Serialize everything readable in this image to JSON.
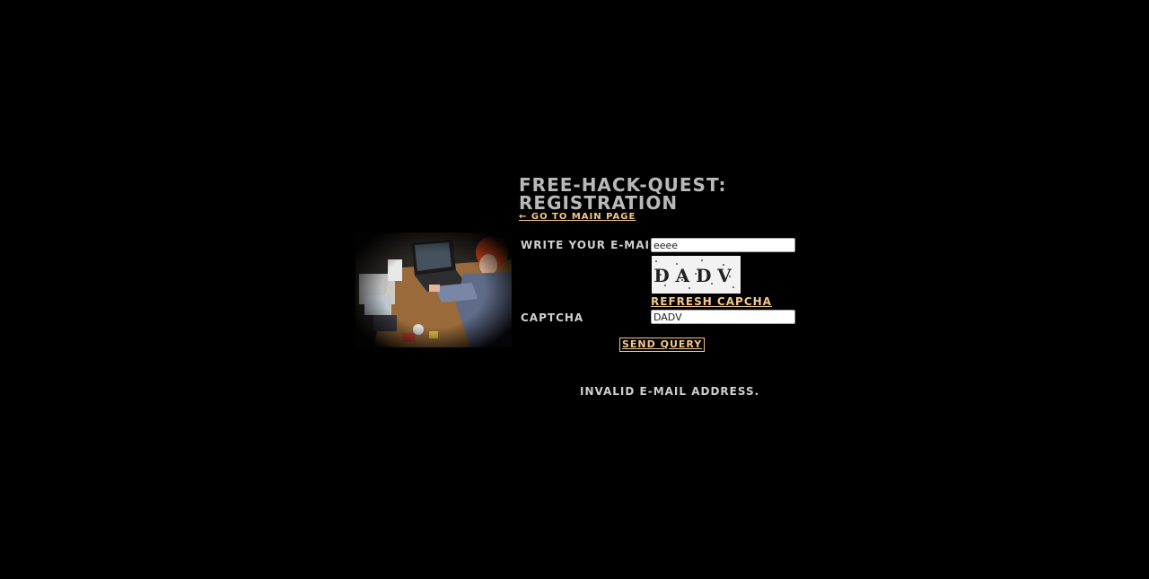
{
  "page": {
    "title_line1": "FREE-HACK-QUEST:",
    "title_line2": "REGISTRATION",
    "back_link": "← GO TO MAIN PAGE"
  },
  "form": {
    "email_label": "WRITE YOUR E-MAIL:",
    "email_value": "eeee",
    "captcha_image_text": "DADV",
    "refresh_link": "REFRESH CAPCHA",
    "captcha_label": "CAPTCHA",
    "captcha_value": "DADV",
    "send_button": "SEND QUERY"
  },
  "status": {
    "message": "INVALID E-MAIL ADDRESS."
  },
  "colors": {
    "background": "#000000",
    "text": "#c8c8c8",
    "link": "#f4c88a"
  }
}
